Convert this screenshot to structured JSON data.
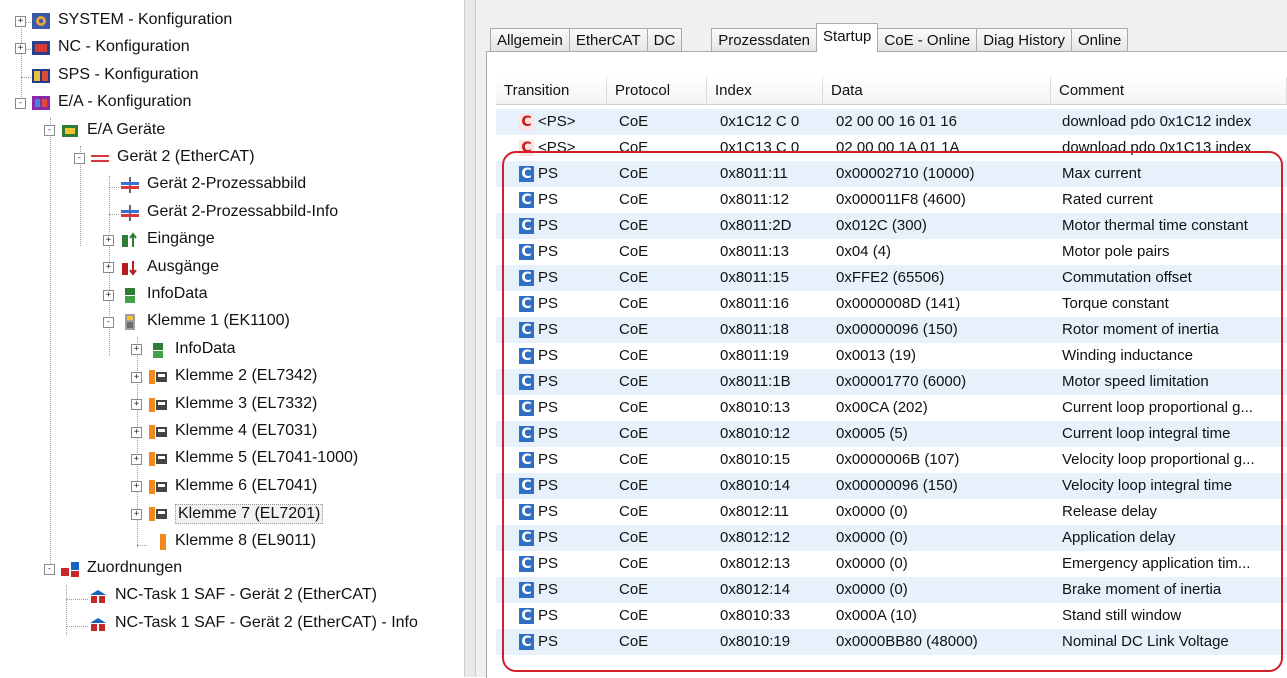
{
  "tree": {
    "items": [
      {
        "label": "SYSTEM - Konfiguration",
        "icon": "system-config-icon",
        "toggle": "+"
      },
      {
        "label": "NC - Konfiguration",
        "icon": "nc-config-icon",
        "toggle": "+"
      },
      {
        "label": "SPS - Konfiguration",
        "icon": "plc-config-icon",
        "toggle": ""
      },
      {
        "label": "E/A - Konfiguration",
        "icon": "io-config-icon",
        "toggle": "-"
      },
      {
        "label": "E/A Geräte",
        "icon": "io-devices-icon",
        "toggle": "-"
      },
      {
        "label": "Gerät 2 (EtherCAT)",
        "icon": "ethercat-device-icon",
        "toggle": "-"
      },
      {
        "label": "Gerät 2-Prozessabbild",
        "icon": "process-image-icon",
        "toggle": ""
      },
      {
        "label": "Gerät 2-Prozessabbild-Info",
        "icon": "process-image-icon",
        "toggle": ""
      },
      {
        "label": "Eingänge",
        "icon": "inputs-icon",
        "toggle": "+"
      },
      {
        "label": "Ausgänge",
        "icon": "outputs-icon",
        "toggle": "+"
      },
      {
        "label": "InfoData",
        "icon": "infodata-icon",
        "toggle": "+"
      },
      {
        "label": "Klemme 1 (EK1100)",
        "icon": "coupler-icon",
        "toggle": "-"
      },
      {
        "label": "InfoData",
        "icon": "infodata-icon",
        "toggle": "+"
      },
      {
        "label": "Klemme 2 (EL7342)",
        "icon": "terminal-icon",
        "toggle": "+"
      },
      {
        "label": "Klemme 3 (EL7332)",
        "icon": "terminal-icon",
        "toggle": "+"
      },
      {
        "label": "Klemme 4 (EL7031)",
        "icon": "terminal-icon",
        "toggle": "+"
      },
      {
        "label": "Klemme 5 (EL7041-1000)",
        "icon": "terminal-icon",
        "toggle": "+"
      },
      {
        "label": "Klemme 6 (EL7041)",
        "icon": "terminal-icon",
        "toggle": "+"
      },
      {
        "label": "Klemme 7 (EL7201)",
        "icon": "terminal-icon",
        "toggle": "+",
        "selected": true
      },
      {
        "label": "Klemme 8 (EL9011)",
        "icon": "end-terminal-icon",
        "toggle": ""
      },
      {
        "label": "Zuordnungen",
        "icon": "mappings-icon",
        "toggle": "-"
      },
      {
        "label": "NC-Task 1 SAF - Gerät 2 (EtherCAT)",
        "icon": "mapping-link-icon",
        "toggle": ""
      },
      {
        "label": "NC-Task 1 SAF - Gerät 2 (EtherCAT) - Info",
        "icon": "mapping-link-icon",
        "toggle": ""
      }
    ]
  },
  "tabs": [
    {
      "label": "Allgemein",
      "active": false
    },
    {
      "label": "EtherCAT",
      "active": false
    },
    {
      "label": "DC",
      "active": false
    },
    {
      "label": "Prozessdaten",
      "active": false
    },
    {
      "label": "Startup",
      "active": true
    },
    {
      "label": "CoE - Online",
      "active": false
    },
    {
      "label": "Diag History",
      "active": false
    },
    {
      "label": "Online",
      "active": false
    }
  ],
  "grid": {
    "columns": [
      "Transition",
      "Protocol",
      "Index",
      "Data",
      "Comment"
    ],
    "rows": [
      {
        "icon": "C",
        "icon_style": "red",
        "transition": "<PS>",
        "protocol": "CoE",
        "index": "0x1C12 C 0",
        "data": "02 00 00 16 01 16",
        "comment": "download pdo 0x1C12 index"
      },
      {
        "icon": "C",
        "icon_style": "red",
        "transition": "<PS>",
        "protocol": "CoE",
        "index": "0x1C13 C 0",
        "data": "02 00 00 1A 01 1A",
        "comment": "download pdo 0x1C13 index"
      },
      {
        "icon": "C",
        "icon_style": "blue",
        "transition": "PS",
        "protocol": "CoE",
        "index": "0x8011:11",
        "data": "0x00002710 (10000)",
        "comment": "Max current"
      },
      {
        "icon": "C",
        "icon_style": "blue",
        "transition": "PS",
        "protocol": "CoE",
        "index": "0x8011:12",
        "data": "0x000011F8 (4600)",
        "comment": "Rated current"
      },
      {
        "icon": "C",
        "icon_style": "blue",
        "transition": "PS",
        "protocol": "CoE",
        "index": "0x8011:2D",
        "data": "0x012C (300)",
        "comment": "Motor thermal time constant"
      },
      {
        "icon": "C",
        "icon_style": "blue",
        "transition": "PS",
        "protocol": "CoE",
        "index": "0x8011:13",
        "data": "0x04 (4)",
        "comment": "Motor pole pairs"
      },
      {
        "icon": "C",
        "icon_style": "blue",
        "transition": "PS",
        "protocol": "CoE",
        "index": "0x8011:15",
        "data": "0xFFE2 (65506)",
        "comment": "Commutation offset"
      },
      {
        "icon": "C",
        "icon_style": "blue",
        "transition": "PS",
        "protocol": "CoE",
        "index": "0x8011:16",
        "data": "0x0000008D (141)",
        "comment": "Torque constant"
      },
      {
        "icon": "C",
        "icon_style": "blue",
        "transition": "PS",
        "protocol": "CoE",
        "index": "0x8011:18",
        "data": "0x00000096 (150)",
        "comment": "Rotor moment of inertia"
      },
      {
        "icon": "C",
        "icon_style": "blue",
        "transition": "PS",
        "protocol": "CoE",
        "index": "0x8011:19",
        "data": "0x0013 (19)",
        "comment": "Winding inductance"
      },
      {
        "icon": "C",
        "icon_style": "blue",
        "transition": "PS",
        "protocol": "CoE",
        "index": "0x8011:1B",
        "data": "0x00001770 (6000)",
        "comment": "Motor speed limitation"
      },
      {
        "icon": "C",
        "icon_style": "blue",
        "transition": "PS",
        "protocol": "CoE",
        "index": "0x8010:13",
        "data": "0x00CA (202)",
        "comment": "Current loop proportional g..."
      },
      {
        "icon": "C",
        "icon_style": "blue",
        "transition": "PS",
        "protocol": "CoE",
        "index": "0x8010:12",
        "data": "0x0005 (5)",
        "comment": "Current loop integral time"
      },
      {
        "icon": "C",
        "icon_style": "blue",
        "transition": "PS",
        "protocol": "CoE",
        "index": "0x8010:15",
        "data": "0x0000006B (107)",
        "comment": "Velocity loop proportional g..."
      },
      {
        "icon": "C",
        "icon_style": "blue",
        "transition": "PS",
        "protocol": "CoE",
        "index": "0x8010:14",
        "data": "0x00000096 (150)",
        "comment": "Velocity loop integral time"
      },
      {
        "icon": "C",
        "icon_style": "blue",
        "transition": "PS",
        "protocol": "CoE",
        "index": "0x8012:11",
        "data": "0x0000 (0)",
        "comment": "Release delay"
      },
      {
        "icon": "C",
        "icon_style": "blue",
        "transition": "PS",
        "protocol": "CoE",
        "index": "0x8012:12",
        "data": "0x0000 (0)",
        "comment": "Application delay"
      },
      {
        "icon": "C",
        "icon_style": "blue",
        "transition": "PS",
        "protocol": "CoE",
        "index": "0x8012:13",
        "data": "0x0000 (0)",
        "comment": "Emergency application tim..."
      },
      {
        "icon": "C",
        "icon_style": "blue",
        "transition": "PS",
        "protocol": "CoE",
        "index": "0x8012:14",
        "data": "0x0000 (0)",
        "comment": "Brake moment of inertia"
      },
      {
        "icon": "C",
        "icon_style": "blue",
        "transition": "PS",
        "protocol": "CoE",
        "index": "0x8010:33",
        "data": "0x000A (10)",
        "comment": "Stand still window"
      },
      {
        "icon": "C",
        "icon_style": "blue",
        "transition": "PS",
        "protocol": "CoE",
        "index": "0x8010:19",
        "data": "0x0000BB80 (48000)",
        "comment": "Nominal DC Link Voltage"
      }
    ]
  },
  "colors": {
    "highlight": "#d21f2a",
    "row_alt": "#e7f1fb",
    "icon_blue": "#2f6fc4",
    "icon_red": "#c21c1c"
  }
}
